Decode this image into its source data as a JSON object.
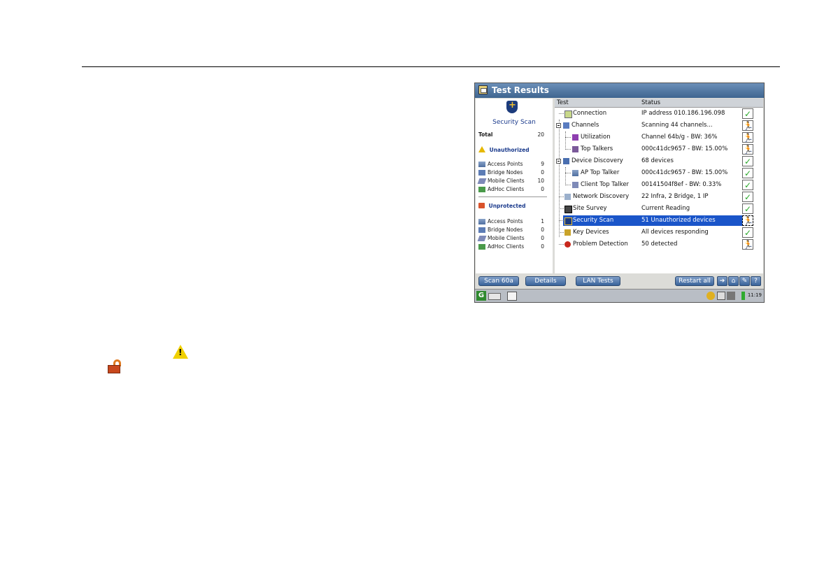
{
  "window": {
    "title": "Test Results"
  },
  "left_panel": {
    "title": "Security Scan",
    "total_label": "Total",
    "total_value": "20",
    "unauthorized": {
      "label": "Unauthorized",
      "items": [
        {
          "label": "Access Points",
          "value": "9",
          "icon": "access-point-icon"
        },
        {
          "label": "Bridge Nodes",
          "value": "0",
          "icon": "bridge-node-icon"
        },
        {
          "label": "Mobile Clients",
          "value": "10",
          "icon": "mobile-client-icon"
        },
        {
          "label": "AdHoc Clients",
          "value": "0",
          "icon": "adhoc-client-icon"
        }
      ]
    },
    "unprotected": {
      "label": "Unprotected",
      "items": [
        {
          "label": "Access Points",
          "value": "1",
          "icon": "access-point-icon"
        },
        {
          "label": "Bridge Nodes",
          "value": "0",
          "icon": "bridge-node-icon"
        },
        {
          "label": "Mobile Clients",
          "value": "0",
          "icon": "mobile-client-icon"
        },
        {
          "label": "AdHoc Clients",
          "value": "0",
          "icon": "adhoc-client-icon"
        }
      ]
    }
  },
  "table": {
    "headers": [
      "Test",
      "Status"
    ],
    "rows": [
      {
        "name": "Connection",
        "status": "IP address 010.186.196.098",
        "state": "passed",
        "icon": "connection-icon"
      },
      {
        "name": "Channels",
        "status": "Scanning 44 channels...",
        "state": "running",
        "icon": "channels-icon"
      },
      {
        "name": "Utilization",
        "status": "Channel 64b/g - BW: 36%",
        "state": "running",
        "icon": "utilization-icon"
      },
      {
        "name": "Top Talkers",
        "status": "000c41dc9657 - BW: 15.00%",
        "state": "running",
        "icon": "top-talkers-icon"
      },
      {
        "name": "Device Discovery",
        "status": "68 devices",
        "state": "passed",
        "icon": "device-discovery-icon"
      },
      {
        "name": "AP Top Talker",
        "status": "000c41dc9657 - BW: 15.00%",
        "state": "passed",
        "icon": "ap-top-talker-icon"
      },
      {
        "name": "Client Top Talker",
        "status": "00141504f8ef - BW: 0.33%",
        "state": "passed",
        "icon": "client-top-talker-icon"
      },
      {
        "name": "Network Discovery",
        "status": "22 Infra, 2 Bridge, 1 IP",
        "state": "passed",
        "icon": "network-discovery-icon"
      },
      {
        "name": "Site Survey",
        "status": "Current Reading",
        "state": "passed",
        "icon": "site-survey-icon"
      },
      {
        "name": "Security Scan",
        "status": "51 Unauthorized devices",
        "state": "running",
        "icon": "security-scan-icon",
        "selected": true
      },
      {
        "name": "Key Devices",
        "status": "All devices responding",
        "state": "passed",
        "icon": "key-devices-icon"
      },
      {
        "name": "Problem Detection",
        "status": "50 detected",
        "state": "running",
        "icon": "problem-detection-icon"
      }
    ]
  },
  "buttons": {
    "scan": "Scan 60a",
    "details": "Details",
    "lan_tests": "LAN Tests",
    "restart_all": "Restart all",
    "help": "?"
  },
  "taskbar": {
    "clock": "11:19"
  },
  "colors": {
    "selection": "#1a55c9",
    "pass": "#2aa82a",
    "title_bar": "#3e6590"
  }
}
